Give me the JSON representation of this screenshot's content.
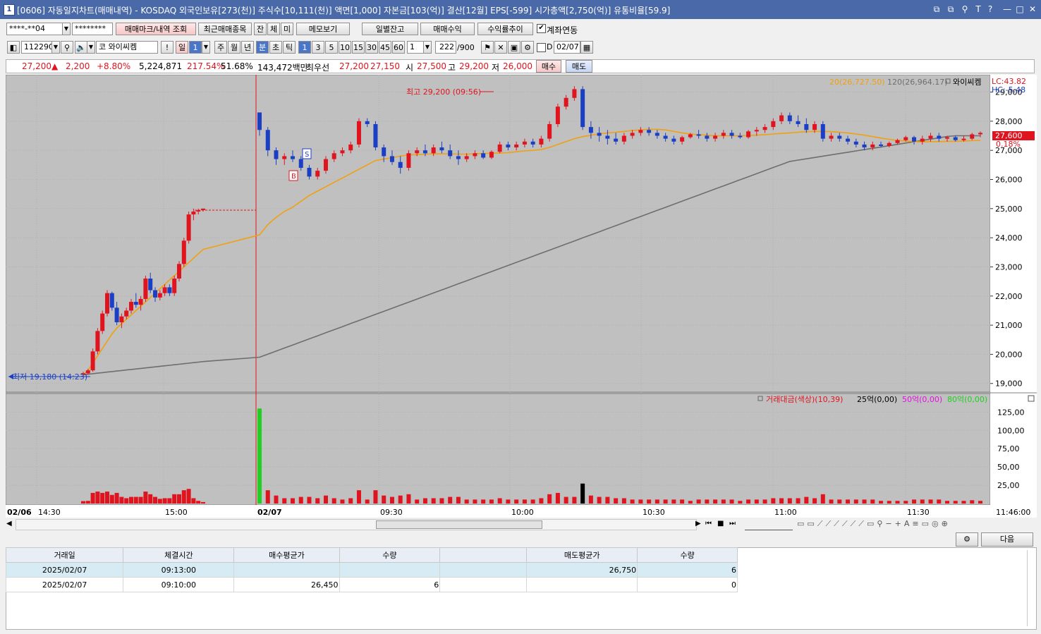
{
  "window": {
    "icon_label": "1",
    "title": "[0606] 자동일지차트(매매내역) - KOSDAQ 외국인보유[273(천)] 주식수[10,111(천)] 액면[1,000] 자본금[103(억)] 결산[12월] EPS[-599] 시가총액[2,750(억)] 유통비율[59.9]",
    "controls": [
      "⧉",
      "⧉",
      "⚲",
      "T",
      "?",
      "—",
      "□",
      "✕"
    ]
  },
  "toolbar1": {
    "account": "****-**04",
    "password": "********",
    "btn_marks": "매매마크/내역 조회",
    "btn_recent": "최근매매종목",
    "tab_jan": "잔",
    "tab_che": "체",
    "tab_mi": "미",
    "btn_memo": "메모보기",
    "btn_daily": "일별잔고",
    "btn_profit": "매매수익",
    "btn_trend": "수익률추이",
    "check_account": "계좌연동"
  },
  "toolbar2": {
    "code": "112290",
    "market": "코",
    "name": "와이씨켐",
    "exclaim": "!",
    "period_day": "일",
    "period_day_n": "1",
    "periods": [
      "주",
      "월",
      "년",
      "분",
      "초",
      "틱"
    ],
    "minutes": [
      "1",
      "3",
      "5",
      "10",
      "15",
      "30",
      "45",
      "60"
    ],
    "count": "1",
    "bars": "222",
    "bars_total": "/900",
    "check_d": "D",
    "date": "02/07"
  },
  "quote": {
    "price": "27,200",
    "arrow": "▲",
    "change": "2,200",
    "rate": "+8.80%",
    "volume": "5,224,871",
    "vol_ratio": "217.54%",
    "turnover": "51.68%",
    "amount": "143,472백만",
    "best_label": "최우선",
    "best_ask": "27,200",
    "best_bid": "27,150",
    "open_label": "시",
    "open": "27,500",
    "high_label": "고",
    "high": "29,200",
    "low_label": "저",
    "low": "26,000",
    "btn_buy": "매수",
    "btn_sell": "매도"
  },
  "chart_data": [
    {
      "type": "line",
      "title": "와이씨켐",
      "legend": [
        "20(26,727.50)",
        "120(26,964.17)",
        "와이씨켐"
      ],
      "legend_colors": [
        "#f0a010",
        "#6e6e6e",
        "#000000"
      ],
      "lc_label": "LC:43.82",
      "hc_label": "HC:-5.48",
      "current_price_label": "27,600",
      "current_rate_label": "0.18%",
      "y_ticks": [
        "29,000",
        "28,000",
        "27,000",
        "26,000",
        "25,000",
        "24,000",
        "23,000",
        "22,000",
        "21,000",
        "20,000",
        "19,000"
      ],
      "y_values": [
        29000,
        28000,
        27000,
        26000,
        25000,
        24000,
        23000,
        22000,
        21000,
        20000,
        19000
      ],
      "ylim": [
        18800,
        29400
      ],
      "x_ticks": [
        "02/06",
        "14:30",
        "15:00",
        "02/07",
        "09:30",
        "10:00",
        "10:30",
        "11:00",
        "11:30",
        "11:46:00"
      ],
      "annotations": {
        "high": "최고 29,200 (09:56)",
        "low": "최저 19,180 (14:23)",
        "sell_mark": "S",
        "buy_mark": "B"
      },
      "ohlc": [
        [
          19300,
          19400,
          19220,
          19350
        ],
        [
          19350,
          19500,
          19300,
          19450
        ],
        [
          19450,
          20200,
          19400,
          20100
        ],
        [
          20100,
          20900,
          20000,
          20800
        ],
        [
          20800,
          21500,
          20700,
          21400
        ],
        [
          21400,
          22200,
          21300,
          22100
        ],
        [
          22100,
          22150,
          21500,
          21600
        ],
        [
          21600,
          21800,
          21000,
          21100
        ],
        [
          21100,
          21400,
          20900,
          21300
        ],
        [
          21300,
          21600,
          21200,
          21500
        ],
        [
          21500,
          21900,
          21400,
          21800
        ],
        [
          21800,
          22100,
          21600,
          21700
        ],
        [
          21700,
          22000,
          21500,
          21900
        ],
        [
          21900,
          22700,
          21800,
          22600
        ],
        [
          22600,
          22800,
          22100,
          22200
        ],
        [
          22200,
          22300,
          21800,
          21950
        ],
        [
          21950,
          22200,
          21850,
          22100
        ],
        [
          22100,
          22400,
          22000,
          22300
        ],
        [
          22300,
          22400,
          22000,
          22100
        ],
        [
          22100,
          22700,
          22000,
          22600
        ],
        [
          22600,
          23200,
          22500,
          23100
        ],
        [
          23100,
          24000,
          23000,
          23900
        ],
        [
          23900,
          24900,
          23800,
          24800
        ],
        [
          24800,
          25000,
          24600,
          24900
        ],
        [
          24900,
          25000,
          24800,
          24950
        ],
        [
          24950,
          25000,
          24900,
          25000
        ],
        [
          28300,
          28300,
          27500,
          27700
        ],
        [
          27700,
          27800,
          26800,
          27000
        ],
        [
          27000,
          27100,
          26500,
          26700
        ],
        [
          26700,
          26900,
          26500,
          26800
        ],
        [
          26800,
          27000,
          26600,
          26700
        ],
        [
          26700,
          26800,
          26300,
          26400
        ],
        [
          26400,
          26500,
          26000,
          26100
        ],
        [
          26100,
          26400,
          26000,
          26300
        ],
        [
          26300,
          26800,
          26200,
          26700
        ],
        [
          26700,
          27000,
          26600,
          26900
        ],
        [
          26900,
          27100,
          26800,
          27000
        ],
        [
          27000,
          27300,
          26900,
          27200
        ],
        [
          27200,
          28100,
          27100,
          28000
        ],
        [
          28000,
          28100,
          27800,
          27900
        ],
        [
          27900,
          28000,
          27000,
          27100
        ],
        [
          27100,
          27200,
          26600,
          26800
        ],
        [
          26800,
          27000,
          26500,
          26600
        ],
        [
          26600,
          26800,
          26200,
          26400
        ],
        [
          26400,
          27000,
          26300,
          26900
        ],
        [
          26900,
          27100,
          26800,
          27000
        ],
        [
          27000,
          27200,
          26800,
          26900
        ],
        [
          26900,
          27200,
          26800,
          27100
        ],
        [
          27100,
          27300,
          26900,
          27000
        ],
        [
          27000,
          27200,
          26700,
          26800
        ],
        [
          26800,
          27000,
          26500,
          26700
        ],
        [
          26700,
          26900,
          26600,
          26800
        ],
        [
          26800,
          27000,
          26700,
          26900
        ],
        [
          26900,
          27000,
          26700,
          26750
        ],
        [
          26750,
          27000,
          26700,
          26950
        ],
        [
          26950,
          27300,
          26900,
          27200
        ],
        [
          27200,
          27300,
          27000,
          27100
        ],
        [
          27100,
          27300,
          27000,
          27200
        ],
        [
          27200,
          27400,
          27100,
          27300
        ],
        [
          27300,
          27400,
          27100,
          27200
        ],
        [
          27200,
          27500,
          27100,
          27400
        ],
        [
          27400,
          28000,
          27300,
          27900
        ],
        [
          27900,
          28600,
          27800,
          28500
        ],
        [
          28500,
          28900,
          28400,
          28800
        ],
        [
          28800,
          29200,
          28700,
          29100
        ],
        [
          29100,
          29200,
          27700,
          27800
        ],
        [
          27800,
          28000,
          27400,
          27600
        ],
        [
          27600,
          27800,
          27300,
          27500
        ],
        [
          27500,
          27700,
          27200,
          27400
        ],
        [
          27400,
          27600,
          27200,
          27300
        ],
        [
          27300,
          27600,
          27200,
          27500
        ],
        [
          27500,
          27700,
          27400,
          27600
        ],
        [
          27600,
          27800,
          27500,
          27700
        ],
        [
          27700,
          27800,
          27500,
          27600
        ],
        [
          27600,
          27700,
          27400,
          27500
        ],
        [
          27500,
          27600,
          27300,
          27400
        ],
        [
          27400,
          27500,
          27200,
          27300
        ],
        [
          27300,
          27500,
          27200,
          27450
        ],
        [
          27450,
          27600,
          27400,
          27550
        ],
        [
          27550,
          27700,
          27400,
          27500
        ],
        [
          27500,
          27600,
          27300,
          27400
        ],
        [
          27400,
          27600,
          27300,
          27500
        ],
        [
          27500,
          27700,
          27400,
          27600
        ],
        [
          27600,
          27700,
          27400,
          27500
        ],
        [
          27500,
          27600,
          27400,
          27450
        ],
        [
          27450,
          27700,
          27400,
          27650
        ],
        [
          27650,
          27800,
          27500,
          27700
        ],
        [
          27700,
          27900,
          27600,
          27800
        ],
        [
          27800,
          28100,
          27700,
          28000
        ],
        [
          28000,
          28300,
          27900,
          28200
        ],
        [
          28200,
          28300,
          27900,
          28000
        ],
        [
          28000,
          28200,
          27800,
          27900
        ],
        [
          27900,
          28100,
          27600,
          27700
        ],
        [
          27700,
          28000,
          27600,
          27900
        ],
        [
          27900,
          28000,
          27300,
          27400
        ],
        [
          27400,
          27600,
          27300,
          27500
        ],
        [
          27500,
          27600,
          27300,
          27400
        ],
        [
          27400,
          27500,
          27200,
          27300
        ],
        [
          27300,
          27400,
          27100,
          27200
        ],
        [
          27200,
          27300,
          27000,
          27100
        ],
        [
          27100,
          27300,
          27000,
          27200
        ],
        [
          27200,
          27300,
          27100,
          27150
        ],
        [
          27150,
          27300,
          27100,
          27250
        ],
        [
          27250,
          27400,
          27200,
          27350
        ],
        [
          27350,
          27500,
          27300,
          27450
        ],
        [
          27450,
          27500,
          27200,
          27300
        ],
        [
          27300,
          27500,
          27200,
          27400
        ],
        [
          27400,
          27600,
          27300,
          27500
        ],
        [
          27500,
          27600,
          27300,
          27400
        ],
        [
          27400,
          27500,
          27300,
          27450
        ],
        [
          27450,
          27500,
          27300,
          27350
        ],
        [
          27350,
          27500,
          27300,
          27400
        ],
        [
          27400,
          27600,
          27350,
          27550
        ],
        [
          27550,
          27650,
          27450,
          27600
        ]
      ],
      "ma20": [
        19300,
        19450,
        19700,
        19950,
        20200,
        20450,
        20700,
        20900,
        21050,
        21200,
        21350,
        21500,
        21650,
        21800,
        21950,
        22100,
        22250,
        22400,
        22550,
        22700,
        22850,
        23000,
        23150,
        23300,
        23450,
        23600,
        24100,
        24450,
        24700,
        24900,
        25050,
        25250,
        25450,
        25600,
        25750,
        25900,
        26050,
        26200,
        26350,
        26500,
        26650,
        26700,
        26750,
        26800,
        26850,
        26850,
        26870,
        26880,
        26880,
        26880,
        26870,
        26870,
        26880,
        26890,
        26900,
        26910,
        26920,
        26950,
        26980,
        27000,
        27030,
        27100,
        27200,
        27300,
        27400,
        27470,
        27520,
        27560,
        27600,
        27620,
        27650,
        27680,
        27700,
        27720,
        27720,
        27700,
        27650,
        27600,
        27560,
        27540,
        27520,
        27500,
        27500,
        27500,
        27500,
        27510,
        27520,
        27540,
        27560,
        27580,
        27600,
        27620,
        27640,
        27650,
        27650,
        27640,
        27620,
        27600,
        27560,
        27520,
        27470,
        27420,
        27380,
        27340,
        27320,
        27300,
        27290,
        27300,
        27300,
        27310,
        27310,
        27320,
        27330,
        27340
      ]
    },
    {
      "type": "bar",
      "title": "거래대금(색상)",
      "legend": [
        "거래대금(색상)(10,39)",
        "25억(0,00)",
        "50억(0,00)",
        "80억(0,00)"
      ],
      "legend_colors": [
        "#e0141e",
        "#000000",
        "#e010e0",
        "#20d020"
      ],
      "y_ticks": [
        "125,00",
        "100,00",
        "75,00",
        "50,00",
        "25,00"
      ],
      "y_values": [
        125,
        100,
        75,
        50,
        25
      ],
      "ylim": [
        0,
        135
      ]
    }
  ],
  "bottom": {
    "btn_next": "다음",
    "headers": [
      "거래일",
      "체결시간",
      "매수평균가",
      "수량",
      "",
      "매도평균가",
      "수량"
    ],
    "rows": [
      [
        "2025/02/07",
        "09:13:00",
        "",
        "",
        "",
        "26,750",
        "6"
      ],
      [
        "2025/02/07",
        "09:10:00",
        "26,450",
        "6",
        "",
        "",
        "0"
      ]
    ]
  }
}
